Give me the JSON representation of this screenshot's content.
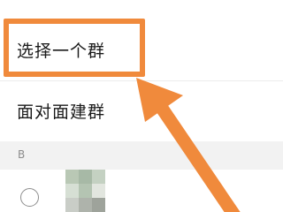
{
  "menu": {
    "select_group_label": "选择一个群",
    "face_to_face_label": "面对面建群"
  },
  "contacts": {
    "section_letter": "B"
  },
  "colors": {
    "highlight": "#f08a3c",
    "section_bg": "#f2f2f2"
  },
  "icons": {
    "radio": "radio-unchecked-icon",
    "annotation": "arrow-pointer-icon"
  }
}
